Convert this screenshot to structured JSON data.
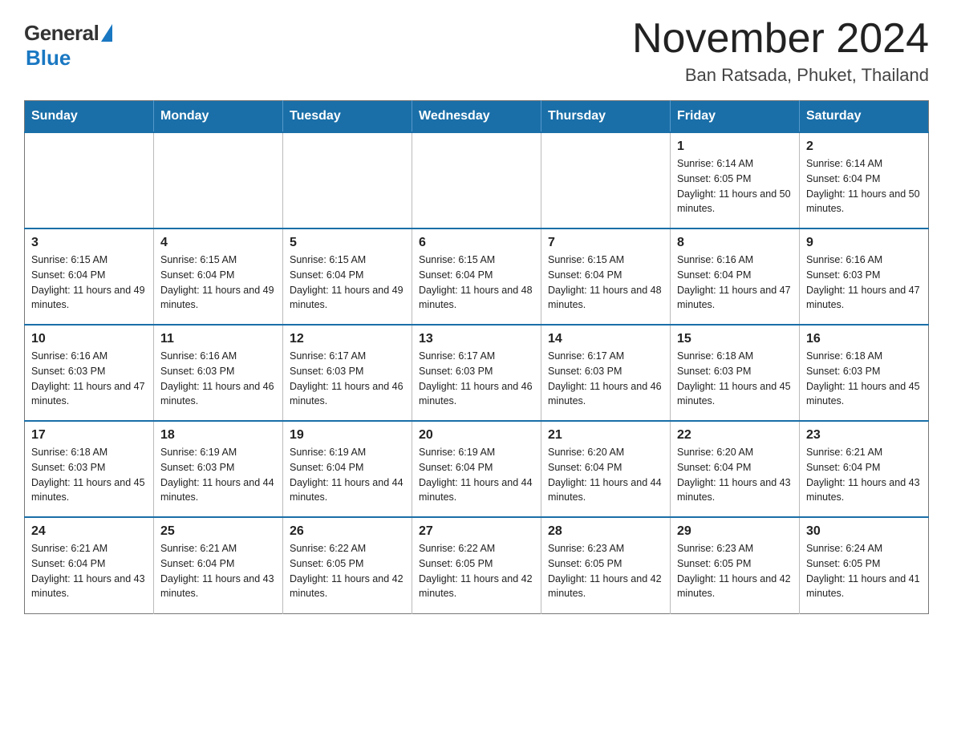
{
  "logo": {
    "general": "General",
    "blue": "Blue"
  },
  "title": "November 2024",
  "location": "Ban Ratsada, Phuket, Thailand",
  "days_of_week": [
    "Sunday",
    "Monday",
    "Tuesday",
    "Wednesday",
    "Thursday",
    "Friday",
    "Saturday"
  ],
  "weeks": [
    [
      {
        "day": "",
        "info": ""
      },
      {
        "day": "",
        "info": ""
      },
      {
        "day": "",
        "info": ""
      },
      {
        "day": "",
        "info": ""
      },
      {
        "day": "",
        "info": ""
      },
      {
        "day": "1",
        "info": "Sunrise: 6:14 AM\nSunset: 6:05 PM\nDaylight: 11 hours and 50 minutes."
      },
      {
        "day": "2",
        "info": "Sunrise: 6:14 AM\nSunset: 6:04 PM\nDaylight: 11 hours and 50 minutes."
      }
    ],
    [
      {
        "day": "3",
        "info": "Sunrise: 6:15 AM\nSunset: 6:04 PM\nDaylight: 11 hours and 49 minutes."
      },
      {
        "day": "4",
        "info": "Sunrise: 6:15 AM\nSunset: 6:04 PM\nDaylight: 11 hours and 49 minutes."
      },
      {
        "day": "5",
        "info": "Sunrise: 6:15 AM\nSunset: 6:04 PM\nDaylight: 11 hours and 49 minutes."
      },
      {
        "day": "6",
        "info": "Sunrise: 6:15 AM\nSunset: 6:04 PM\nDaylight: 11 hours and 48 minutes."
      },
      {
        "day": "7",
        "info": "Sunrise: 6:15 AM\nSunset: 6:04 PM\nDaylight: 11 hours and 48 minutes."
      },
      {
        "day": "8",
        "info": "Sunrise: 6:16 AM\nSunset: 6:04 PM\nDaylight: 11 hours and 47 minutes."
      },
      {
        "day": "9",
        "info": "Sunrise: 6:16 AM\nSunset: 6:03 PM\nDaylight: 11 hours and 47 minutes."
      }
    ],
    [
      {
        "day": "10",
        "info": "Sunrise: 6:16 AM\nSunset: 6:03 PM\nDaylight: 11 hours and 47 minutes."
      },
      {
        "day": "11",
        "info": "Sunrise: 6:16 AM\nSunset: 6:03 PM\nDaylight: 11 hours and 46 minutes."
      },
      {
        "day": "12",
        "info": "Sunrise: 6:17 AM\nSunset: 6:03 PM\nDaylight: 11 hours and 46 minutes."
      },
      {
        "day": "13",
        "info": "Sunrise: 6:17 AM\nSunset: 6:03 PM\nDaylight: 11 hours and 46 minutes."
      },
      {
        "day": "14",
        "info": "Sunrise: 6:17 AM\nSunset: 6:03 PM\nDaylight: 11 hours and 46 minutes."
      },
      {
        "day": "15",
        "info": "Sunrise: 6:18 AM\nSunset: 6:03 PM\nDaylight: 11 hours and 45 minutes."
      },
      {
        "day": "16",
        "info": "Sunrise: 6:18 AM\nSunset: 6:03 PM\nDaylight: 11 hours and 45 minutes."
      }
    ],
    [
      {
        "day": "17",
        "info": "Sunrise: 6:18 AM\nSunset: 6:03 PM\nDaylight: 11 hours and 45 minutes."
      },
      {
        "day": "18",
        "info": "Sunrise: 6:19 AM\nSunset: 6:03 PM\nDaylight: 11 hours and 44 minutes."
      },
      {
        "day": "19",
        "info": "Sunrise: 6:19 AM\nSunset: 6:04 PM\nDaylight: 11 hours and 44 minutes."
      },
      {
        "day": "20",
        "info": "Sunrise: 6:19 AM\nSunset: 6:04 PM\nDaylight: 11 hours and 44 minutes."
      },
      {
        "day": "21",
        "info": "Sunrise: 6:20 AM\nSunset: 6:04 PM\nDaylight: 11 hours and 44 minutes."
      },
      {
        "day": "22",
        "info": "Sunrise: 6:20 AM\nSunset: 6:04 PM\nDaylight: 11 hours and 43 minutes."
      },
      {
        "day": "23",
        "info": "Sunrise: 6:21 AM\nSunset: 6:04 PM\nDaylight: 11 hours and 43 minutes."
      }
    ],
    [
      {
        "day": "24",
        "info": "Sunrise: 6:21 AM\nSunset: 6:04 PM\nDaylight: 11 hours and 43 minutes."
      },
      {
        "day": "25",
        "info": "Sunrise: 6:21 AM\nSunset: 6:04 PM\nDaylight: 11 hours and 43 minutes."
      },
      {
        "day": "26",
        "info": "Sunrise: 6:22 AM\nSunset: 6:05 PM\nDaylight: 11 hours and 42 minutes."
      },
      {
        "day": "27",
        "info": "Sunrise: 6:22 AM\nSunset: 6:05 PM\nDaylight: 11 hours and 42 minutes."
      },
      {
        "day": "28",
        "info": "Sunrise: 6:23 AM\nSunset: 6:05 PM\nDaylight: 11 hours and 42 minutes."
      },
      {
        "day": "29",
        "info": "Sunrise: 6:23 AM\nSunset: 6:05 PM\nDaylight: 11 hours and 42 minutes."
      },
      {
        "day": "30",
        "info": "Sunrise: 6:24 AM\nSunset: 6:05 PM\nDaylight: 11 hours and 41 minutes."
      }
    ]
  ]
}
